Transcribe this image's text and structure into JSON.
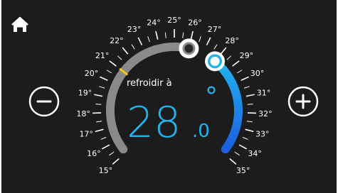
{
  "home": {
    "icon": "home-icon"
  },
  "buttons": {
    "decrease": {
      "icon": "minus-icon"
    },
    "increase": {
      "icon": "plus-icon"
    }
  },
  "mode": {
    "label": "refroidir à"
  },
  "setpoint": {
    "integer": "28",
    "decimal": ".0",
    "degree": "°",
    "value": 28.0
  },
  "current_temperature": 26,
  "marker_temperature": 21,
  "scale": {
    "min": 15,
    "max": 35,
    "labels": [
      "15°",
      "16°",
      "17°",
      "18°",
      "19°",
      "20°",
      "21°",
      "22°",
      "23°",
      "24°",
      "25°",
      "26°",
      "27°",
      "28°",
      "29°",
      "30°",
      "31°",
      "32°",
      "33°",
      "34°",
      "35°"
    ]
  },
  "colors": {
    "background": "#1c1c1c",
    "accent": "#22b3ee",
    "accent_dark": "#1c5fe0",
    "track": "#8a8a8a",
    "marker": "#f5c518",
    "text": "#ffffff"
  }
}
